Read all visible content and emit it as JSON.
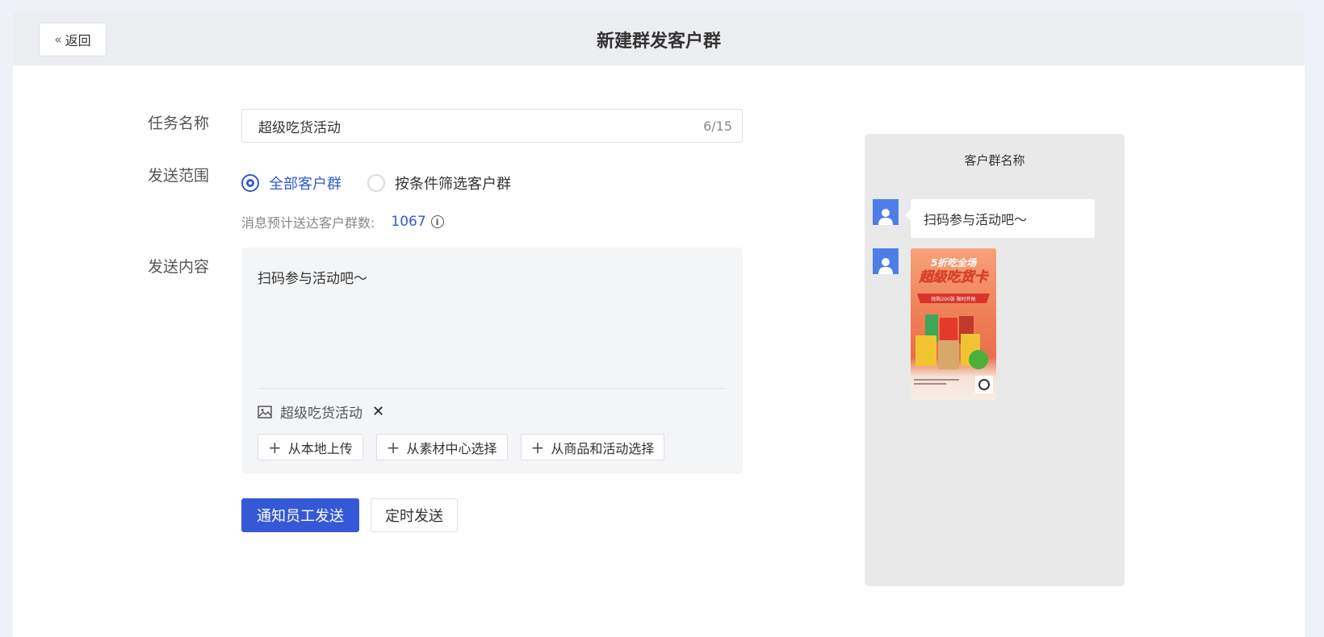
{
  "header": {
    "back_label": "返回",
    "title": "新建群发客户群"
  },
  "form": {
    "task_name_label": "任务名称",
    "task_name_value": "超级吃货活动",
    "task_name_count": "6/15",
    "scope_label": "发送范围",
    "scope_options": [
      "全部客户群",
      "按条件筛选客户群"
    ],
    "scope_selected": "全部客户群",
    "estimate_label": "消息预计送达客户群数:",
    "estimate_value": "1067",
    "content_label": "发送内容",
    "content_text": "扫码参与活动吧～",
    "attachment_name": "超级吃货活动",
    "upload_buttons": [
      "从本地上传",
      "从素材中心选择",
      "从商品和活动选择"
    ]
  },
  "actions": {
    "primary": "通知员工发送",
    "secondary": "定时发送"
  },
  "preview": {
    "title": "客户群名称",
    "message_text": "扫码参与活动吧～",
    "poster": {
      "headline_top": "5折吃全场",
      "headline_main": "超级吃货卡",
      "banner": "抢购200张 限时开抢"
    }
  },
  "colors": {
    "accent": "#3559d6",
    "avatar": "#4e7de8"
  }
}
